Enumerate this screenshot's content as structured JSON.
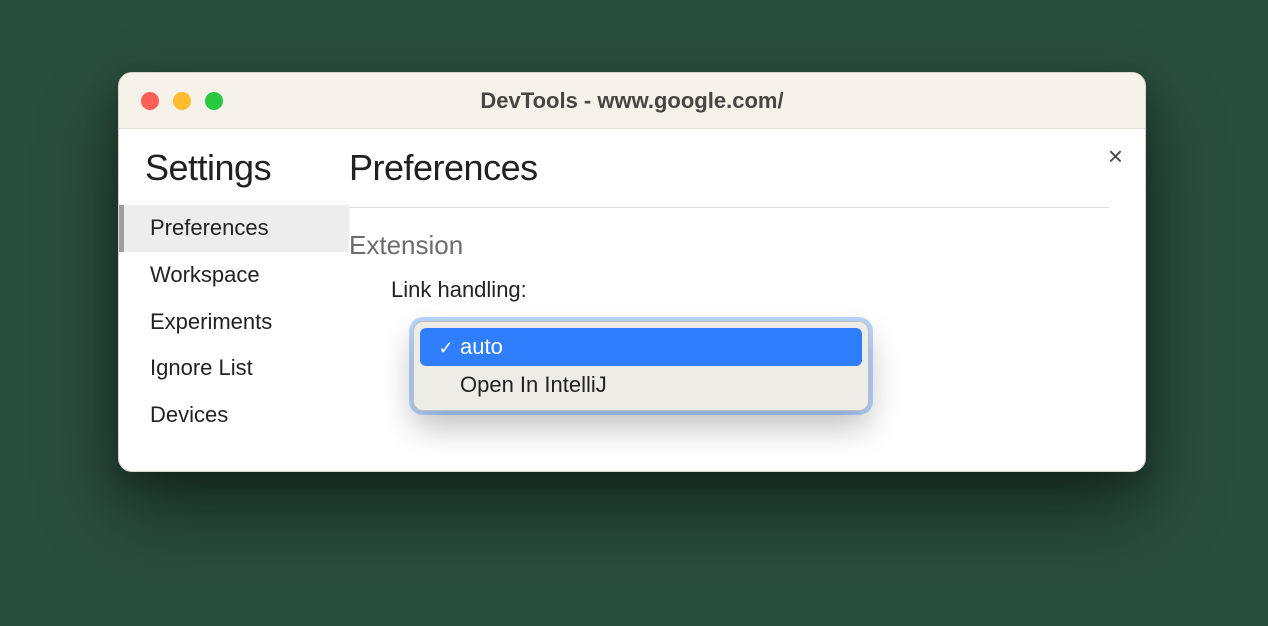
{
  "window": {
    "title": "DevTools - www.google.com/"
  },
  "sidebar": {
    "heading": "Settings",
    "items": [
      {
        "label": "Preferences",
        "active": true
      },
      {
        "label": "Workspace",
        "active": false
      },
      {
        "label": "Experiments",
        "active": false
      },
      {
        "label": "Ignore List",
        "active": false
      },
      {
        "label": "Devices",
        "active": false
      }
    ]
  },
  "main": {
    "title": "Preferences",
    "section": "Extension",
    "field": {
      "label": "Link handling:",
      "selected": "auto",
      "options": [
        {
          "label": "auto",
          "selected": true
        },
        {
          "label": "Open In IntelliJ",
          "selected": false
        }
      ]
    }
  },
  "close_label": "×",
  "check_glyph": "✓"
}
